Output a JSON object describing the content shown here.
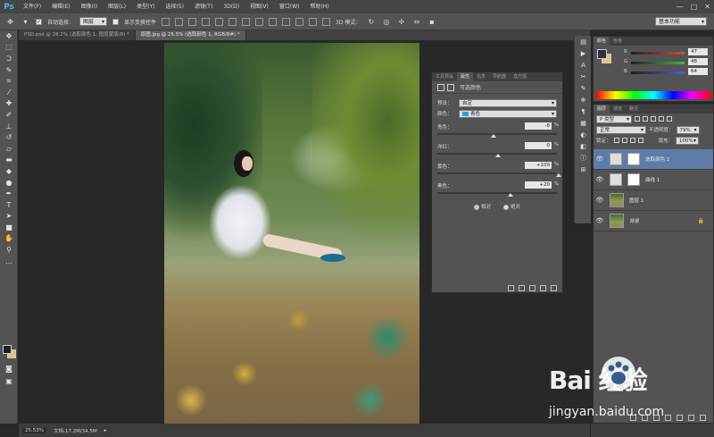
{
  "app": {
    "logo": "Ps"
  },
  "menubar": {
    "items": [
      "文件(F)",
      "编辑(E)",
      "图像(I)",
      "图层(L)",
      "类型(Y)",
      "选择(S)",
      "滤镜(T)",
      "3D(D)",
      "视图(V)",
      "窗口(W)",
      "帮助(H)"
    ],
    "window_controls": [
      "—",
      "□",
      "✕"
    ]
  },
  "options_bar": {
    "auto_select_label": "自动选择：",
    "auto_select_value": "图层",
    "show_transform_label": "显示变换控件",
    "mode_3d_label": "3D 模式：",
    "workspace": "基本功能"
  },
  "document_tabs": [
    {
      "label": "PSD.psd @ 28.2% (选取颜色 1, 图层蒙版/8) *",
      "active": false
    },
    {
      "label": "原图.jpg @ 25.5% (选取颜色 1, RGB/8#) *",
      "active": true
    }
  ],
  "properties_panel": {
    "tabs": [
      "工具预设",
      "属性",
      "信息",
      "导航器",
      "直方图"
    ],
    "active_tab": "属性",
    "title": "可选颜色",
    "preset_label": "预设：",
    "preset_value": "自定",
    "colors_label": "颜色：",
    "colors_value": "青色",
    "sliders": [
      {
        "label": "青色：",
        "value": "-8",
        "unit": "%",
        "level": -8
      },
      {
        "label": "洋红：",
        "value": "0",
        "unit": "%",
        "level": 0
      },
      {
        "label": "黄色：",
        "value": "+100",
        "unit": "%",
        "level": 100
      },
      {
        "label": "黑色：",
        "value": "+20",
        "unit": "%",
        "level": 20
      }
    ],
    "method_relative": "相对",
    "method_absolute": "绝对",
    "method_selected": "相对"
  },
  "color_panel": {
    "tabs": [
      "颜色",
      "色板"
    ],
    "channels": [
      {
        "name": "R",
        "value": "47",
        "color": "#d04848"
      },
      {
        "name": "G",
        "value": "48",
        "color": "#48b048"
      },
      {
        "name": "B",
        "value": "64",
        "color": "#4860d0"
      }
    ],
    "foreground": "#2f3040"
  },
  "layers_panel": {
    "tabs": [
      "图层",
      "通道",
      "路径"
    ],
    "kind_filter": "P 类型",
    "blend_mode": "正常",
    "opacity_label": "不透明度：",
    "opacity_value": "79%",
    "lock_label": "锁定：",
    "fill_label": "填充：",
    "fill_value": "100%",
    "layers": [
      {
        "name": "选取颜色 1",
        "type": "adjustment",
        "selected": true,
        "visible": true,
        "italic": false,
        "locked": false
      },
      {
        "name": "曲线 1",
        "type": "adjustment",
        "selected": false,
        "visible": true,
        "italic": false,
        "locked": false
      },
      {
        "name": "图层 1",
        "type": "pixel",
        "selected": false,
        "visible": true,
        "italic": false,
        "locked": false
      },
      {
        "name": "背景",
        "type": "pixel",
        "selected": false,
        "visible": true,
        "italic": true,
        "locked": true
      }
    ]
  },
  "status_bar": {
    "zoom": "25.53%",
    "doc_info": "文档:17.2M/34.5M"
  },
  "watermark": {
    "brand": "Bai 经验",
    "site": "jingyan.baidu.com"
  }
}
